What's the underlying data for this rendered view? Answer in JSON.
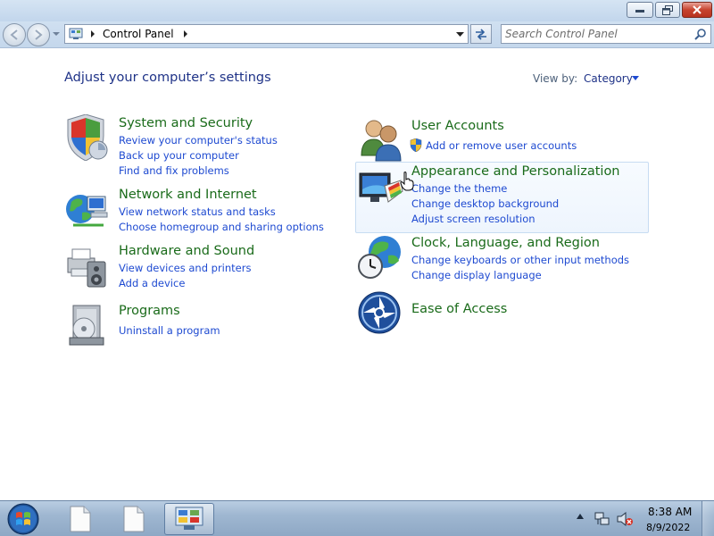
{
  "window": {
    "minimize_icon": "minimize-icon",
    "maximize_icon": "restore-icon",
    "close_icon": "close-icon"
  },
  "address": {
    "crumb": "Control Panel",
    "search_placeholder": "Search Control Panel"
  },
  "page": {
    "title": "Adjust your computer’s settings",
    "view_by_label": "View by:",
    "view_by_value": "Category"
  },
  "categories": [
    {
      "title": "System and Security",
      "icon": "shield-icon",
      "links": [
        "Review your computer's status",
        "Back up your computer",
        "Find and fix problems"
      ]
    },
    {
      "title": "Network and Internet",
      "icon": "network-globe-icon",
      "links": [
        "View network status and tasks",
        "Choose homegroup and sharing options"
      ]
    },
    {
      "title": "Hardware and Sound",
      "icon": "printer-speaker-icon",
      "links": [
        "View devices and printers",
        "Add a device"
      ]
    },
    {
      "title": "Programs",
      "icon": "programs-disc-icon",
      "links": [
        "Uninstall a program"
      ]
    },
    {
      "title": "User Accounts",
      "icon": "users-icon",
      "links": [
        "Add or remove user accounts"
      ]
    },
    {
      "title": "Appearance and Personalization",
      "icon": "monitor-palette-icon",
      "links": [
        "Change the theme",
        "Change desktop background",
        "Adjust screen resolution"
      ]
    },
    {
      "title": "Clock, Language, and Region",
      "icon": "globe-clock-icon",
      "links": [
        "Change keyboards or other input methods",
        "Change display language"
      ]
    },
    {
      "title": "Ease of Access",
      "icon": "ease-of-access-icon",
      "links": []
    }
  ],
  "taskbar": {
    "clock_time": "8:38 AM",
    "clock_date": "8/9/2022"
  },
  "colors": {
    "title_blue": "#1e3287",
    "category_green": "#1a6b1a",
    "link_blue": "#1e4ad1",
    "taskbar": "#9fb7d1"
  }
}
